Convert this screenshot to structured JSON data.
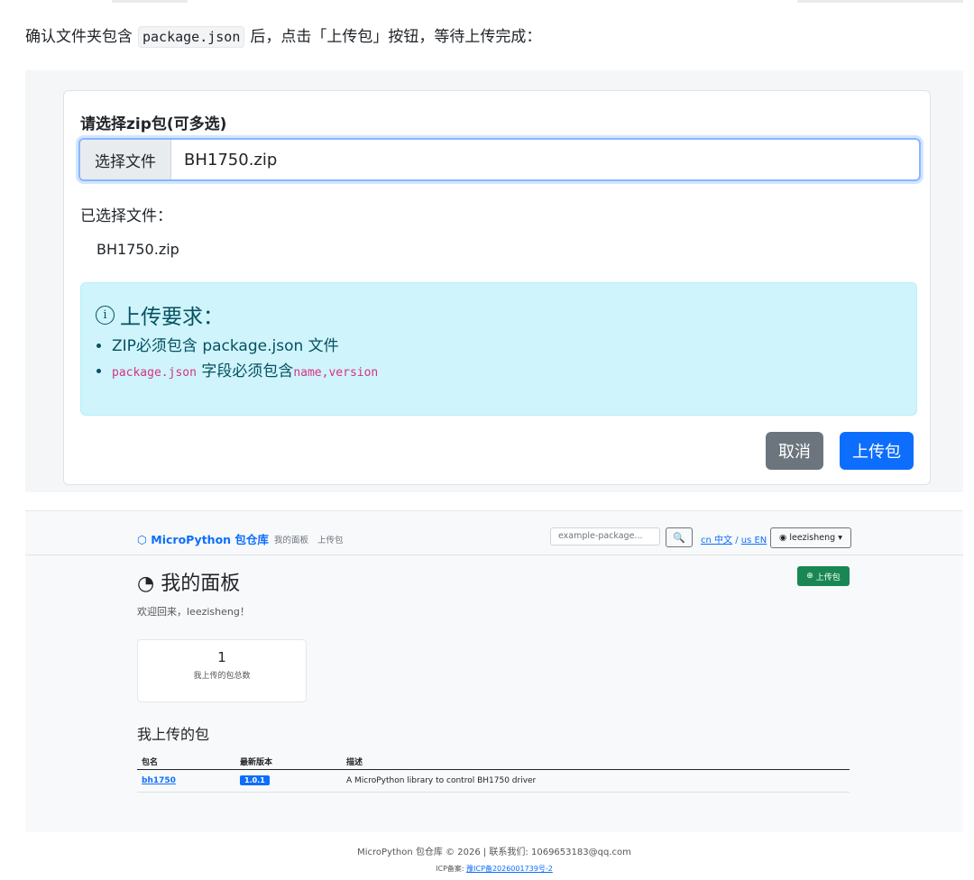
{
  "intro": {
    "before": "确认文件夹包含",
    "code": "package.json",
    "after": "后，点击「上传包」按钮，等待上传完成："
  },
  "upload_form": {
    "label": "请选择zip包(可多选)",
    "file_button": "选择文件",
    "file_value": "BH1750.zip",
    "selected_label": "已选择文件：",
    "selected_files": [
      "BH1750.zip"
    ],
    "alert": {
      "title": "上传要求：",
      "item1": "ZIP必须包含 package.json 文件",
      "item2_code": "package.json",
      "item2_text": "字段必须包含",
      "item2_fields": "name,version"
    },
    "cancel_label": "取消",
    "upload_label": "上传包"
  },
  "dashboard": {
    "brand": "MicroPython 包仓库",
    "nav": [
      "我的面板",
      "上传包"
    ],
    "search_placeholder": "example-package...",
    "lang_cn": "cn 中文",
    "lang_sep": "/",
    "lang_en": "us EN",
    "user": "leezisheng",
    "title": "我的面板",
    "welcome": "欢迎回来，leezisheng！",
    "new_upload_label": "上传包",
    "stat": {
      "value": "1",
      "label": "我上传的包总数"
    },
    "section_title": "我上传的包",
    "table": {
      "headers": [
        "包名",
        "最新版本",
        "描述"
      ],
      "rows": [
        {
          "name": "bh1750",
          "version": "1.0.1",
          "description": "A MicroPython library to control BH1750 driver"
        }
      ]
    }
  },
  "footer": {
    "line1": "MicroPython 包仓库 © 2026 | 联系我们: 1069653183@qq.com",
    "icp_label": "ICP备案:",
    "icp_link": "豫ICP备2026001739号-2"
  }
}
